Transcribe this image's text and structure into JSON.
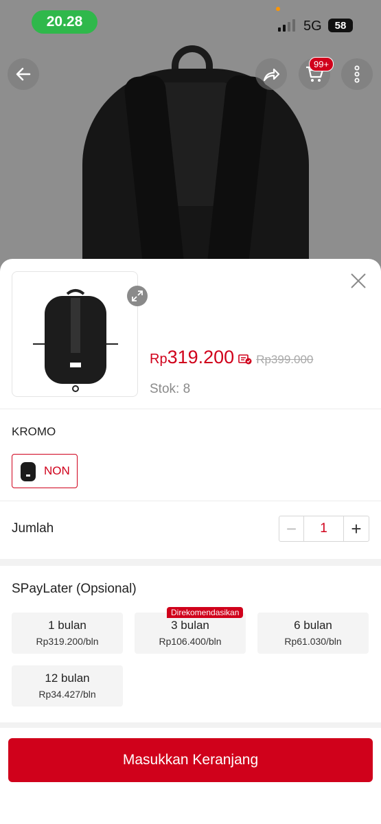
{
  "status_bar": {
    "time": "20.28",
    "network": "5G",
    "battery": "58"
  },
  "header": {
    "cart_badge": "99+"
  },
  "product": {
    "currency": "Rp",
    "price": "319.200",
    "original_price": "Rp399.000",
    "stock": "Stok: 8"
  },
  "variation": {
    "title": "KROMO",
    "selected_option": "NON"
  },
  "quantity": {
    "label": "Jumlah",
    "value": "1",
    "minus": "−",
    "plus": "+"
  },
  "paylater": {
    "title": "SPayLater (Opsional)",
    "plans": [
      {
        "term": "1 bulan",
        "price": "Rp319.200/bln"
      },
      {
        "term": "3 bulan",
        "price": "Rp106.400/bln",
        "badge": "Direkomendasikan"
      },
      {
        "term": "6 bulan",
        "price": "Rp61.030/bln"
      },
      {
        "term": "12 bulan",
        "price": "Rp34.427/bln"
      }
    ]
  },
  "cta": {
    "label": "Masukkan Keranjang"
  },
  "colors": {
    "brand": "#d0011b",
    "status_time_bg": "#2fb84b"
  }
}
